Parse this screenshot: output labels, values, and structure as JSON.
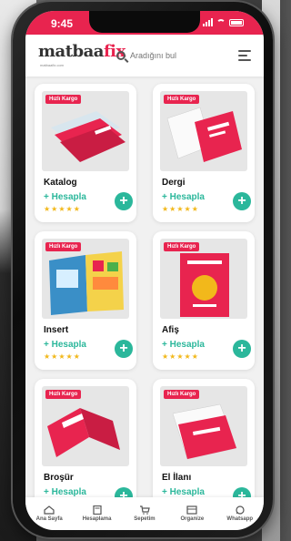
{
  "status": {
    "time": "9:45"
  },
  "header": {
    "logo_main": "matbaa",
    "logo_accent": "fix",
    "logo_tagline": "matbaafix.com",
    "search_placeholder": "Aradığını bul"
  },
  "products": [
    {
      "badge": "Hızlı Kargo",
      "title": "Katalog",
      "action": "+ Hesapla",
      "stars": "★★★★★"
    },
    {
      "badge": "Hızlı Kargo",
      "title": "Dergi",
      "action": "+ Hesapla",
      "stars": "★★★★★"
    },
    {
      "badge": "Hızlı Kargo",
      "title": "Insert",
      "action": "+ Hesapla",
      "stars": "★★★★★"
    },
    {
      "badge": "Hızlı Kargo",
      "title": "Afiş",
      "action": "+ Hesapla",
      "stars": "★★★★★"
    },
    {
      "badge": "Hızlı Kargo",
      "title": "Broşür",
      "action": "+ Hesapla",
      "stars": "★★★★★"
    },
    {
      "badge": "Hızlı Kargo",
      "title": "El İlanı",
      "action": "+ Hesapla",
      "stars": "★★★★★"
    }
  ],
  "bottom_nav": [
    {
      "label": "Ana Sayfa",
      "icon": "home-icon"
    },
    {
      "label": "Hesaplama",
      "icon": "calculator-icon"
    },
    {
      "label": "Sepetim",
      "icon": "cart-icon"
    },
    {
      "label": "Organize",
      "icon": "organize-icon"
    },
    {
      "label": "Whatsapp",
      "icon": "whatsapp-icon"
    }
  ],
  "colors": {
    "brand": "#e8244f",
    "accent": "#2bb79b",
    "star": "#f2b81b"
  }
}
